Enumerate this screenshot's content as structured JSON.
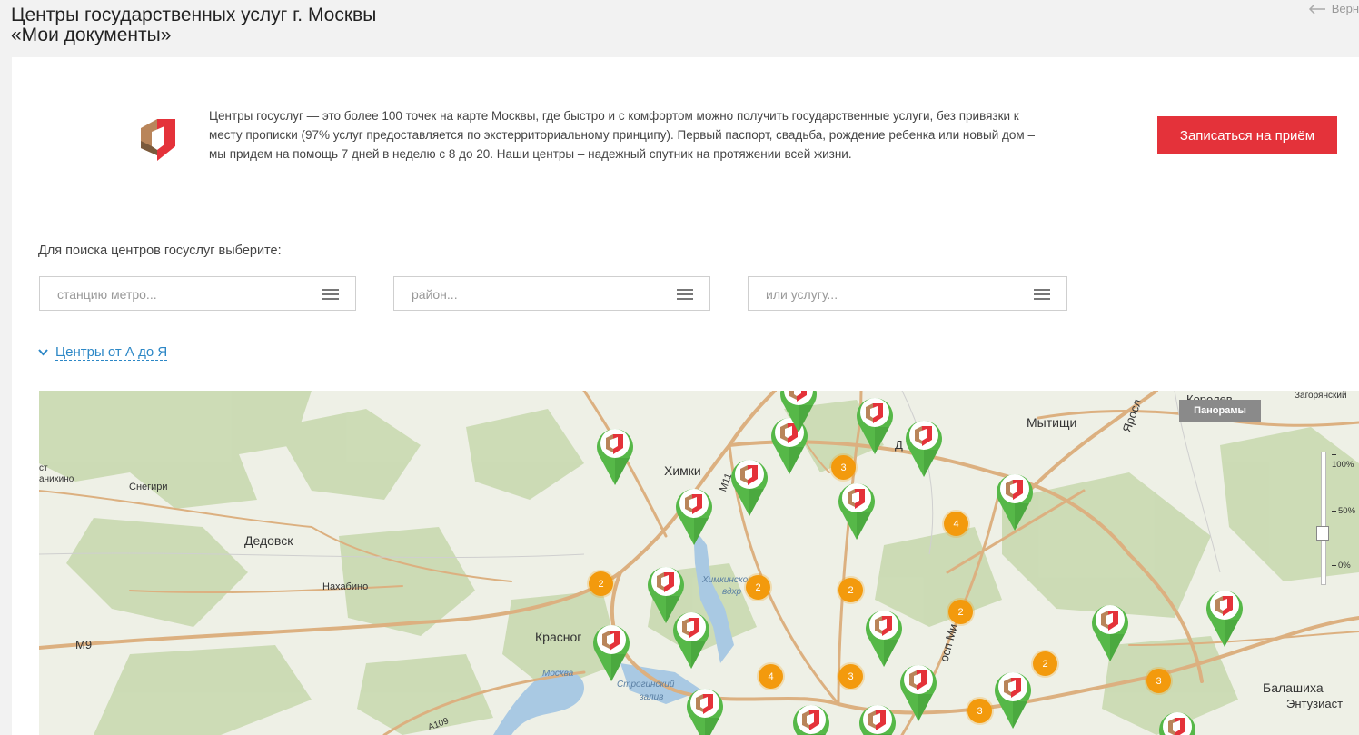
{
  "page": {
    "title_line1": "Центры государственных услуг г. Москвы",
    "title_line2": "«Мои документы»",
    "back_label": "Верн"
  },
  "intro": {
    "text": "Центры госуслуг — это более 100 точек на карте Москвы, где быстро и с комфортом можно получить государственные услуги, без привязки к месту прописки (97% услуг предоставляется по экстерриториальному принципу). Первый паспорт, свадьба, рождение ребенка или новый дом – мы придем на помощь 7 дней в неделю с 8 до 20. Наши центры – надежный спутник на протяжении всей жизни.",
    "cta_label": "Записаться на приём"
  },
  "search": {
    "prompt": "Для поиска центров госуслуг выберите:",
    "metro_placeholder": "станцию метро...",
    "district_placeholder": "район...",
    "service_placeholder": "или услугу...",
    "az_link": "Центры от А до Я"
  },
  "map": {
    "panorama_label": "Панорамы",
    "zoom_ticks": [
      "100%",
      "50%",
      "0%"
    ],
    "place_labels": [
      "Химки",
      "Мытищи",
      "Королев",
      "Загорянский",
      "Дедовск",
      "Снегири",
      "Нахабино",
      "Красног",
      "Балашиха",
      "Энтузиаст",
      "Химкинское",
      "вдхр",
      "Строгинский",
      "залив",
      "Москва",
      "М9",
      "M11",
      "ст",
      "анихино",
      "Яросл",
      "осп Ми",
      "Д",
      "А109"
    ],
    "cluster_counts": [
      "3",
      "4",
      "2",
      "2",
      "2",
      "2",
      "4",
      "3",
      "2",
      "3",
      "3"
    ],
    "pin_icon": "mfc-logo-icon",
    "colors": {
      "pin_green": "#56b848",
      "cluster_orange": "#f39a0d",
      "road": "#dcb080",
      "forest": "#c9d9b0",
      "land": "#eceee4",
      "water": "#a9c9e3",
      "cta_red": "#e4323a",
      "link_blue": "#2c87c6"
    }
  }
}
